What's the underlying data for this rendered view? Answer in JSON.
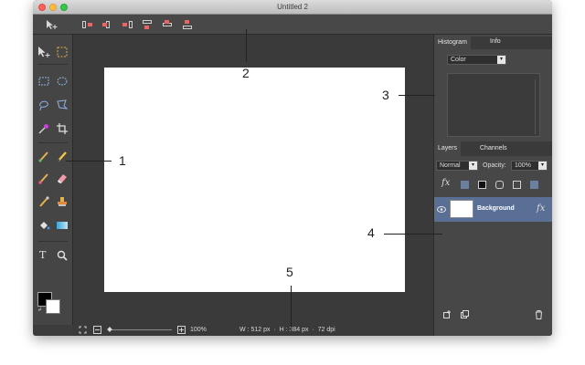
{
  "window": {
    "title": "Untitled 2"
  },
  "zoom": "100%",
  "status_info": "W : 512 px  ·  H : 384 px  ·  72 dpi",
  "panels": {
    "top_tabs": [
      "Histogram",
      "Info"
    ],
    "channel_select": "Color",
    "layer_tabs": [
      "Layers",
      "Channels"
    ],
    "blend_mode": "Normal",
    "opacity_label": "Opacity:",
    "opacity_value": "100%",
    "layer_name": "Background",
    "fx_label": "fx"
  },
  "type_tool_glyph": "T",
  "callouts": {
    "one": "1",
    "two": "2",
    "three": "3",
    "four": "4",
    "five": "5"
  },
  "colors": {
    "window_bg": "#3c3c3c",
    "panel_bg": "#474747",
    "selected_layer": "#5a6f95",
    "foreground_swatch": "#000000",
    "background_swatch": "#ffffff"
  },
  "icons": [
    "move-icon",
    "marquee-icon",
    "ellipse-marquee-icon",
    "rect-select-icon",
    "lasso-icon",
    "polygon-lasso-icon",
    "magic-wand-icon",
    "crop-icon",
    "brush-icon",
    "pencil-icon",
    "eraser-brush-icon",
    "eraser-icon",
    "eyedropper-icon",
    "clone-stamp-icon",
    "paint-bucket-icon",
    "gradient-icon",
    "type-icon",
    "zoom-icon",
    "eye-icon",
    "fx-icon",
    "new-layer-icon",
    "duplicate-layer-icon",
    "trash-icon"
  ]
}
